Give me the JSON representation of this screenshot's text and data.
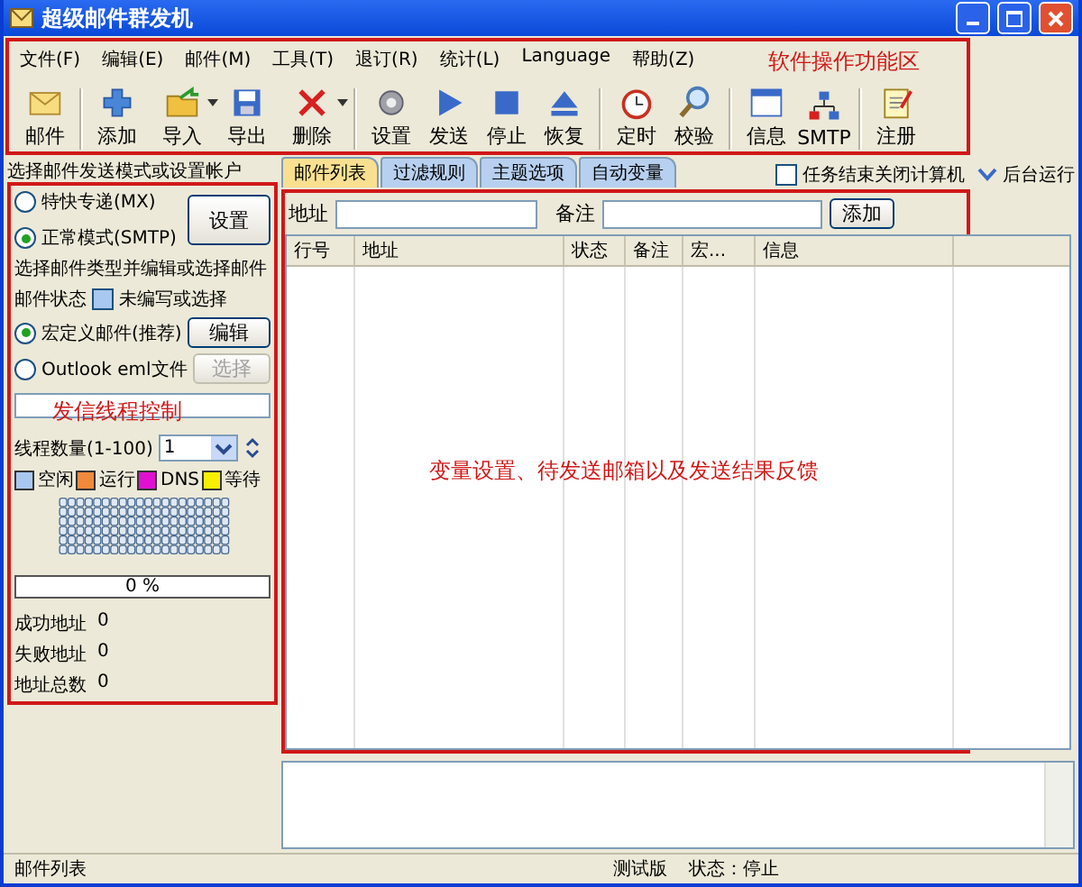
{
  "window": {
    "title": "超级邮件群发机"
  },
  "menu": [
    "文件(F)",
    "编辑(E)",
    "邮件(M)",
    "工具(T)",
    "退订(R)",
    "统计(L)",
    "Language",
    "帮助(Z)"
  ],
  "toolbar": {
    "annotation": "软件操作功能区",
    "items": [
      {
        "label": "邮件",
        "separator_before": false,
        "dropdown": false
      },
      {
        "label": "添加",
        "separator_before": true,
        "dropdown": false
      },
      {
        "label": "导入",
        "separator_before": false,
        "dropdown": true
      },
      {
        "label": "导出",
        "separator_before": false,
        "dropdown": false
      },
      {
        "label": "删除",
        "separator_before": false,
        "dropdown": true
      },
      {
        "label": "设置",
        "separator_before": true,
        "dropdown": false
      },
      {
        "label": "发送",
        "separator_before": false,
        "dropdown": false
      },
      {
        "label": "停止",
        "separator_before": false,
        "dropdown": false
      },
      {
        "label": "恢复",
        "separator_before": false,
        "dropdown": false
      },
      {
        "label": "定时",
        "separator_before": true,
        "dropdown": false
      },
      {
        "label": "校验",
        "separator_before": false,
        "dropdown": false
      },
      {
        "label": "信息",
        "separator_before": true,
        "dropdown": false
      },
      {
        "label": "SMTP",
        "separator_before": false,
        "dropdown": false
      },
      {
        "label": "注册",
        "separator_before": true,
        "dropdown": false
      }
    ]
  },
  "left_panel": {
    "header": "选择邮件发送模式或设置帐户",
    "annotation": "发信线程控制",
    "modes": [
      {
        "label": "特快专递(MX)",
        "selected": false
      },
      {
        "label": "正常模式(SMTP)",
        "selected": true
      }
    ],
    "settings_button": "设置",
    "type_heading": "选择邮件类型并编辑或选择邮件",
    "status_label": "邮件状态",
    "status_text": "未编写或选择",
    "sources": [
      {
        "label": "宏定义邮件(推荐)",
        "selected": true,
        "button": "编辑",
        "disabled": false
      },
      {
        "label": "Outlook eml文件",
        "selected": false,
        "button": "选择",
        "disabled": true
      }
    ],
    "thread_label": "线程数量(1-100)",
    "thread_value": "1",
    "legend": [
      {
        "label": "空闲",
        "color": "#a8c8f0"
      },
      {
        "label": "运行",
        "color": "#f08a3c"
      },
      {
        "label": "DNS",
        "color": "#e010d0"
      },
      {
        "label": "等待",
        "color": "#f8f000"
      }
    ],
    "progress": {
      "level": 0,
      "text": "0 %"
    },
    "stats": [
      {
        "label": "成功地址",
        "value": "0"
      },
      {
        "label": "失败地址",
        "value": "0"
      },
      {
        "label": "地址总数",
        "value": "0"
      }
    ]
  },
  "main": {
    "annotation": "变量设置、待发送邮箱以及发送结果反馈",
    "tabs": [
      {
        "label": "邮件列表",
        "selected": true
      },
      {
        "label": "过滤规则",
        "selected": false
      },
      {
        "label": "主题选项",
        "selected": false
      },
      {
        "label": "自动变量",
        "selected": false
      }
    ],
    "shutdown_checkbox": {
      "label": "任务结束关闭计算机",
      "checked": false
    },
    "background_run": "后台运行",
    "address_label": "地址",
    "note_label": "备注",
    "add_button": "添加",
    "table": {
      "columns": [
        "行号",
        "地址",
        "状态",
        "备注",
        "宏...",
        "信息"
      ]
    }
  },
  "status_bar": [
    "邮件列表",
    "测试版",
    "状态：停止"
  ]
}
